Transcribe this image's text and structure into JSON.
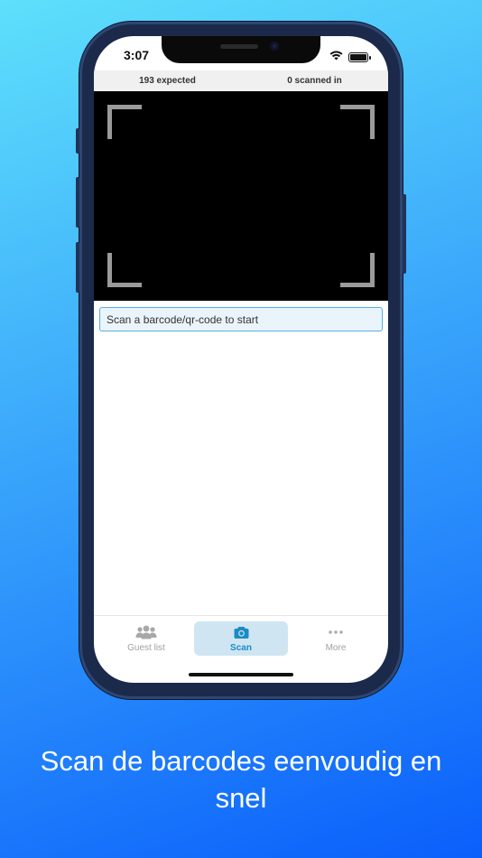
{
  "status_bar": {
    "time": "3:07"
  },
  "stats": {
    "expected": "193 expected",
    "scanned": "0 scanned in"
  },
  "scan": {
    "placeholder": "Scan a barcode/qr-code to start"
  },
  "tabs": [
    {
      "label": "Guest list",
      "icon": "people-icon",
      "active": false
    },
    {
      "label": "Scan",
      "icon": "camera-icon",
      "active": true
    },
    {
      "label": "More",
      "icon": "more-dots-icon",
      "active": false
    }
  ],
  "caption": "Scan de barcodes eenvoudig en snel",
  "colors": {
    "accent": "#1a8bc6",
    "active_tab_bg": "#cfe6f2",
    "inactive": "#a0a0a0"
  }
}
